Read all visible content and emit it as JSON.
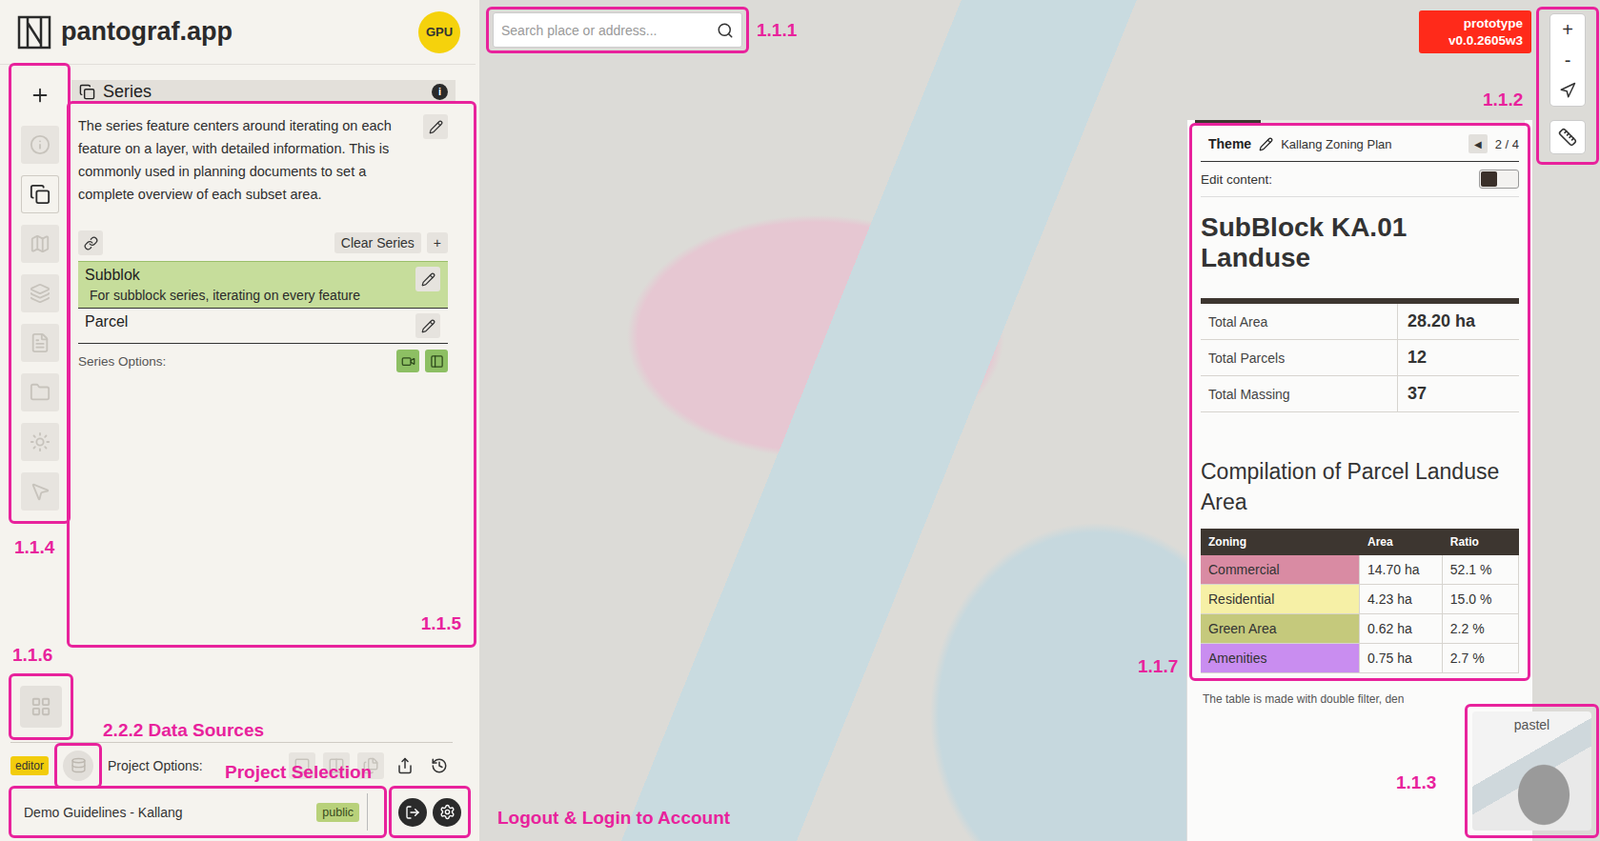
{
  "app": {
    "title": "pantograf.app",
    "badge": "GPU"
  },
  "rail": [
    {
      "kind": "add",
      "selected": false,
      "disabled": false
    },
    {
      "kind": "info",
      "selected": false,
      "disabled": true
    },
    {
      "kind": "series",
      "selected": true,
      "disabled": false
    },
    {
      "kind": "map",
      "selected": false,
      "disabled": true
    },
    {
      "kind": "layers",
      "selected": false,
      "disabled": true
    },
    {
      "kind": "document",
      "selected": false,
      "disabled": true
    },
    {
      "kind": "folder",
      "selected": false,
      "disabled": true
    },
    {
      "kind": "theme",
      "selected": false,
      "disabled": true
    },
    {
      "kind": "select",
      "selected": false,
      "disabled": true
    }
  ],
  "series_panel": {
    "title": "Series",
    "info": "i",
    "description": "The series feature centers around iterating on each feature on a layer, with detailed information. This is commonly used in planning documents to set a complete overview of each subset area.",
    "clear_button": "Clear Series",
    "add_button": "+",
    "items": [
      {
        "name": "Subblok",
        "subtitle": "For subblock series, iterating on every feature",
        "selected": true
      },
      {
        "name": "Parcel",
        "selected": false
      }
    ],
    "options_label": "Series Options:",
    "options": [
      {
        "kind": "camera"
      },
      {
        "kind": "panel"
      }
    ]
  },
  "bottom": {
    "role": "editor",
    "project_options_label": "Project Options:",
    "project_options": [
      {
        "kind": "layout",
        "disabled": true
      },
      {
        "kind": "columns",
        "disabled": true
      },
      {
        "kind": "pages",
        "disabled": true
      },
      {
        "kind": "share",
        "disabled": false
      },
      {
        "kind": "history",
        "disabled": false
      }
    ],
    "project": {
      "name": "Demo Guidelines - Kallang",
      "visibility": "public"
    }
  },
  "map": {
    "search_placeholder": "Search place or address...",
    "build": {
      "line1": "prototype",
      "line2": "v0.0.2605w3"
    },
    "zoom_in": "+",
    "zoom_out": "-",
    "minimap_label": "pastel"
  },
  "theme_panel": {
    "progress_level": 0.2,
    "label": "Theme",
    "name": "Kallang Zoning Plan",
    "prev": "◀",
    "page": "2 / 4",
    "edit_label": "Edit content:",
    "edit_on": false,
    "heading": "SubBlock KA.01 Landuse",
    "summary": [
      {
        "label": "Total Area",
        "value": "28.20 ha"
      },
      {
        "label": "Total Parcels",
        "value": "12"
      },
      {
        "label": "Total Massing",
        "value": "37"
      }
    ],
    "compilation_title": "Compilation of Parcel Landuse Area",
    "columns": [
      "Zoning",
      "Area",
      "Ratio"
    ],
    "rows": [
      {
        "zoning": "Commercial",
        "area": "14.70 ha",
        "ratio": "52.1 %",
        "color": "#d98ba3"
      },
      {
        "zoning": "Residential",
        "area": "4.23 ha",
        "ratio": "15.0 %",
        "color": "#f6f0a6"
      },
      {
        "zoning": "Green Area",
        "area": "0.62 ha",
        "ratio": "2.2 %",
        "color": "#c5c97c"
      },
      {
        "zoning": "Amenities",
        "area": "0.75 ha",
        "ratio": "2.7 %",
        "color": "#c98df0"
      }
    ],
    "note": "The table is made with double filter, den"
  },
  "annotations": {
    "search": "1.1.1",
    "map_controls": "1.1.2",
    "minimap": "1.1.3",
    "toolbar": "1.1.4",
    "series_panel": "1.1.5",
    "layout_button": "1.1.6",
    "theme_panel": "1.1.7",
    "data_sources": "2.2.2 Data Sources",
    "project_selection": "Project Selection",
    "account": "Logout & Login to Account"
  }
}
